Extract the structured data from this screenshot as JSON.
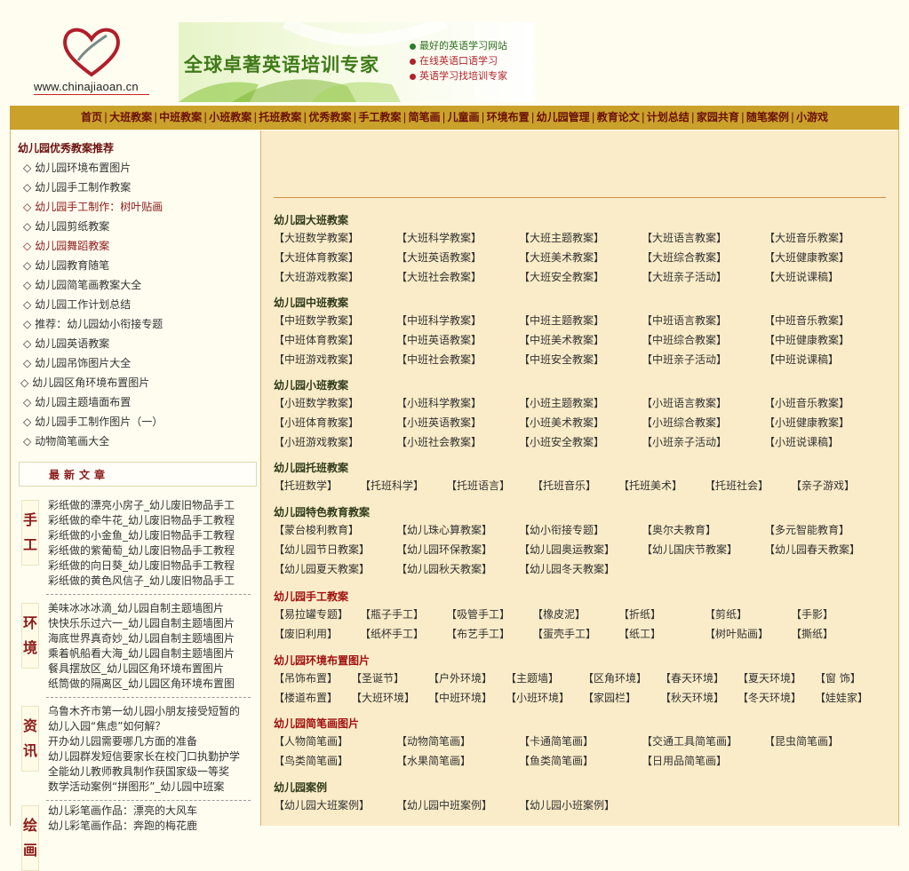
{
  "logo": {
    "url_text": "www.chinajiaoan.cn"
  },
  "banner": {
    "title": "全球卓著英语培训专家",
    "lines": [
      "最好的英语学习网站",
      "在线英语口语学习",
      "英语学习找培训专家"
    ]
  },
  "nav": [
    "首页",
    "大班教案",
    "中班教案",
    "小班教案",
    "托班教案",
    "优秀教案",
    "手工教案",
    "简笔画",
    "儿童画",
    "环境布置",
    "幼儿园管理",
    "教育论文",
    "计划总结",
    "家园共育",
    "随笔案例",
    "小游戏"
  ],
  "sidebar": {
    "recommend_title": "幼儿园优秀教案推荐",
    "recommend": [
      "幼儿园环境布置图片",
      "幼儿园手工制作教案",
      "幼儿园手工制作：树叶贴画",
      "幼儿园剪纸教案",
      "幼儿园舞蹈教案",
      "幼儿园教育随笔",
      "幼儿园简笔画教案大全",
      "幼儿园工作计划总结",
      "推荐：幼儿园幼小衔接专题",
      "幼儿园英语教案",
      "幼儿园吊饰图片大全",
      "幼儿园区角环境布置图片",
      "幼儿园主题墙面布置",
      "幼儿园手工制作图片（一）",
      "动物简笔画大全"
    ],
    "bullet": "◇",
    "latest_title": "最新文章",
    "categories": [
      {
        "label": "手工",
        "items": [
          "彩纸做的漂亮小房子_幼儿废旧物品手工",
          "彩纸做的牵牛花_幼儿废旧物品手工教程",
          "彩纸做的小金鱼_幼儿废旧物品手工教程",
          "彩纸做的紫葡萄_幼儿废旧物品手工教程",
          "彩纸做的向日葵_幼儿废旧物品手工教程",
          "彩纸做的黄色风信子_幼儿废旧物品手工"
        ]
      },
      {
        "label": "环境",
        "items": [
          "美味冰冰冰滴_幼儿园自制主题墙图片",
          "快快乐乐过六一_幼儿园自制主题墙图片",
          "海底世界真奇妙_幼儿园自制主题墙图片",
          "乘着帆船看大海_幼儿园自制主题墙图片",
          "餐具摆放区_幼儿园区角环境布置图片",
          "纸筒做的隔离区_幼儿园区角环境布置图"
        ]
      },
      {
        "label": "资讯",
        "items": [
          "乌鲁木齐市第一幼儿园小朋友接受短暂的",
          "幼儿入园“焦虑”如何解？",
          "开办幼儿园需要哪几方面的准备",
          "幼儿园群发短信要家长在校门口执勤护学",
          "全能幼儿教师教具制作获国家级一等奖",
          "数学活动案例“拼图形”_幼儿园中班案"
        ]
      },
      {
        "label": "绘画",
        "items": [
          "幼儿彩笔画作品：漂亮的大风车",
          "幼儿彩笔画作品：奔跑的梅花鹿"
        ]
      }
    ]
  },
  "main": {
    "sections": [
      {
        "title": "幼儿园大班教案",
        "title_color": "normal",
        "cols": 5,
        "items": [
          "【大班数学教案】",
          "【大班科学教案】",
          "【大班主题教案】",
          "【大班语言教案】",
          "【大班音乐教案】",
          "【大班体育教案】",
          "【大班英语教案】",
          "【大班美术教案】",
          "【大班综合教案】",
          "【大班健康教案】",
          "【大班游戏教案】",
          "【大班社会教案】",
          "【大班安全教案】",
          "【大班亲子活动】",
          "【大班说课稿】"
        ]
      },
      {
        "title": "幼儿园中班教案",
        "title_color": "normal",
        "cols": 5,
        "items": [
          "【中班数学教案】",
          "【中班科学教案】",
          "【中班主题教案】",
          "【中班语言教案】",
          "【中班音乐教案】",
          "【中班体育教案】",
          "【中班英语教案】",
          "【中班美术教案】",
          "【中班综合教案】",
          "【中班健康教案】",
          "【中班游戏教案】",
          "【中班社会教案】",
          "【中班安全教案】",
          "【中班亲子活动】",
          "【中班说课稿】"
        ]
      },
      {
        "title": "幼儿园小班教案",
        "title_color": "normal",
        "cols": 5,
        "items": [
          "【小班数学教案】",
          "【小班科学教案】",
          "【小班主题教案】",
          "【小班语言教案】",
          "【小班音乐教案】",
          "【小班体育教案】",
          "【小班英语教案】",
          "【小班美术教案】",
          "【小班综合教案】",
          "【小班健康教案】",
          "【小班游戏教案】",
          "【小班社会教案】",
          "【小班安全教案】",
          "【小班亲子活动】",
          "【小班说课稿】"
        ]
      },
      {
        "title": "幼儿园托班教案",
        "title_color": "normal",
        "cols": 7,
        "items": [
          "【托班数学】",
          "【托班科学】",
          "【托班语言】",
          "【托班音乐】",
          "【托班美术】",
          "【托班社会】",
          "【亲子游戏】"
        ]
      },
      {
        "title": "幼儿园特色教育教案",
        "title_color": "normal",
        "cols": 5,
        "items": [
          "【蒙台梭利教育】",
          "【幼儿珠心算教案】",
          "【幼小衔接专题】",
          "【奥尔夫教育】",
          "【多元智能教育】",
          "【幼儿园节日教案】",
          "【幼儿园环保教案】",
          "【幼儿园奥运教案】",
          "【幼儿国庆节教案】",
          "【幼儿园春天教案】",
          "【幼儿园夏天教案】",
          "【幼儿园秋天教案】",
          "【幼儿园冬天教案】"
        ]
      },
      {
        "title": "幼儿园手工教案",
        "title_color": "red",
        "cols": 7,
        "items": [
          "【易拉罐专题】",
          "【瓶子手工】",
          "【吸管手工】",
          "【橡皮泥】",
          "【折纸】",
          "【剪纸】",
          "【手影】",
          "【废旧利用】",
          "【纸杯手工】",
          "【布艺手工】",
          "【蛋壳手工】",
          "【纸工】",
          "【树叶贴画】",
          "【撕纸】"
        ]
      },
      {
        "title": "幼儿园环境布置图片",
        "title_color": "red",
        "cols": 8,
        "items": [
          "【吊饰布置】",
          "【圣诞节】",
          "【户外环境】",
          "【主题墙】",
          "【区角环境】",
          "【春天环境】",
          "【夏天环境】",
          "【窗 饰】",
          "【楼道布置】",
          "【大班环境】",
          "【中班环境】",
          "【小班环境】",
          "【家园栏】",
          "【秋天环境】",
          "【冬天环境】",
          "【娃娃家】"
        ]
      },
      {
        "title": "幼儿园简笔画图片",
        "title_color": "red",
        "cols": 5,
        "items": [
          "【人物简笔画】",
          "【动物简笔画】",
          "【卡通简笔画】",
          "【交通工具简笔画】",
          "【昆虫简笔画】",
          "【鸟类简笔画】",
          "【水果简笔画】",
          "【鱼类简笔画】",
          "【日用品简笔画】"
        ]
      },
      {
        "title": "幼儿园案例",
        "title_color": "normal",
        "cols": 5,
        "items": [
          "【幼儿园大班案例】",
          "【幼儿园中班案例】",
          "【幼儿园小班案例】"
        ]
      }
    ]
  }
}
